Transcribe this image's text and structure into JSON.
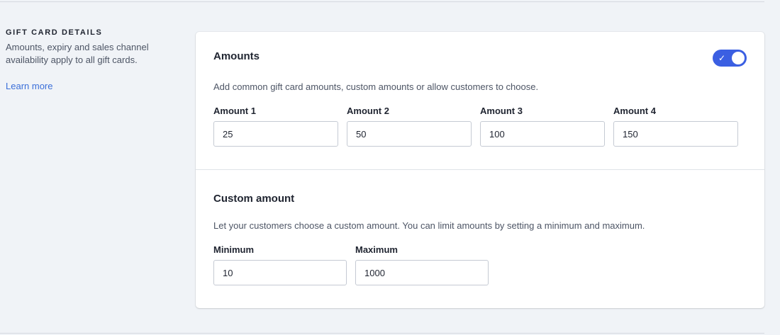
{
  "section": {
    "heading": "GIFT CARD DETAILS",
    "description": "Amounts, expiry and sales channel availability apply to all gift cards.",
    "learn_more": "Learn more"
  },
  "amounts": {
    "title": "Amounts",
    "toggle_on": true,
    "description": "Add common gift card amounts, custom amounts or allow customers to choose.",
    "fields": [
      {
        "label": "Amount 1",
        "value": "25"
      },
      {
        "label": "Amount 2",
        "value": "50"
      },
      {
        "label": "Amount 3",
        "value": "100"
      },
      {
        "label": "Amount 4",
        "value": "150"
      }
    ]
  },
  "custom_amount": {
    "title": "Custom amount",
    "description": "Let your customers choose a custom amount. You can limit amounts by setting a minimum and maximum.",
    "minimum": {
      "label": "Minimum",
      "value": "10"
    },
    "maximum": {
      "label": "Maximum",
      "value": "1000"
    }
  },
  "colors": {
    "accent": "#3b5fe2",
    "link": "#3b6fd9",
    "background": "#f0f3f7"
  },
  "icons": {
    "toggle_check": "✓"
  }
}
